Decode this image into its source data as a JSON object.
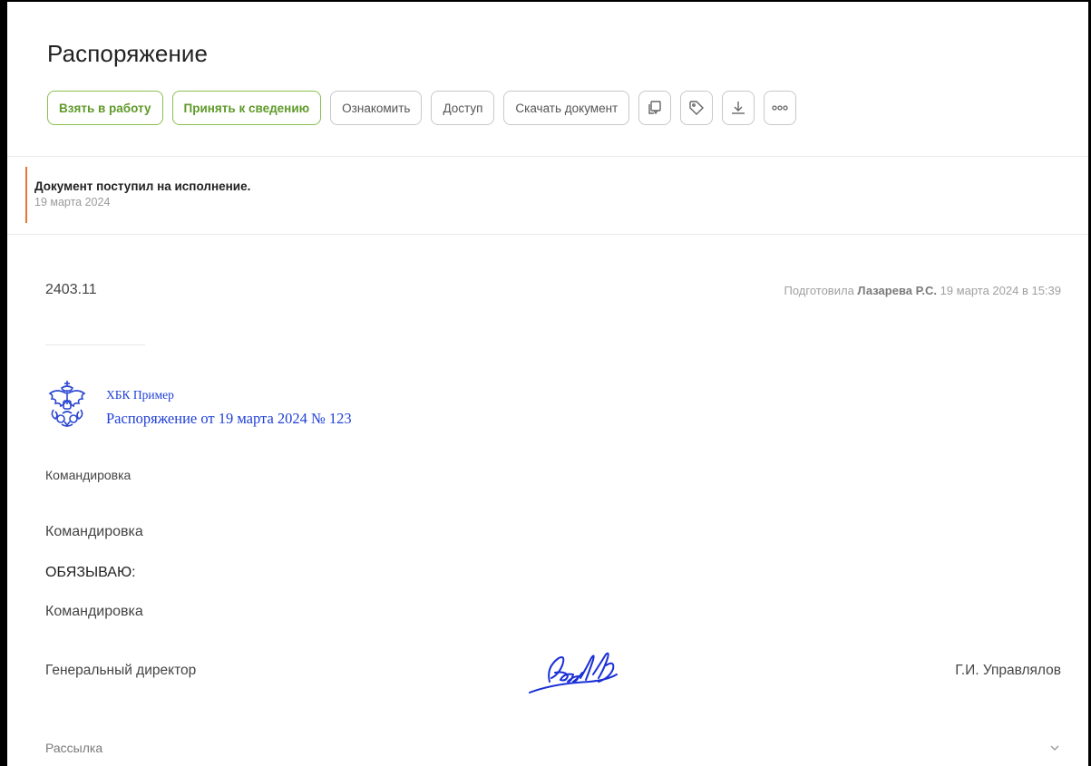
{
  "document": {
    "title": "Распоряжение"
  },
  "toolbar": {
    "take_to_work": "Взять в работу",
    "acknowledge": "Принять к сведению",
    "familiarize": "Ознакомить",
    "access": "Доступ",
    "download_document": "Скачать документ",
    "icons": [
      "resolution-icon",
      "tag-icon",
      "download-icon",
      "more-icon"
    ]
  },
  "notice": {
    "text": "Документ поступил на исполнение.",
    "date": "19 марта 2024"
  },
  "meta": {
    "number": "2403.11",
    "prepared_prefix": "Подготовила",
    "prepared_by": "Лазарева Р.С.",
    "prepared_at": "19 марта 2024 в 15:39"
  },
  "order": {
    "org_name": "ХБК Пример",
    "heading": "Распоряжение от 19 марта 2024 № 123",
    "subject": "Командировка",
    "paragraph1": "Командировка",
    "obligate": "ОБЯЗЫВАЮ:",
    "paragraph2": "Командировка",
    "signer_position": "Генеральный директор",
    "signer_name": "Г.И. Управлялов"
  },
  "footer": {
    "mailing_label": "Рассылка"
  },
  "colors": {
    "accent_green": "#5f9a2a",
    "notice_orange": "#e8772e",
    "doc_blue": "#1f3fd6"
  }
}
